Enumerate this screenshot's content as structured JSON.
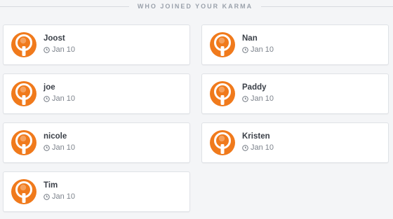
{
  "header": {
    "title": "WHO JOINED YOUR KARMA"
  },
  "members": [
    {
      "name": "Joost",
      "date": "Jan 10"
    },
    {
      "name": "Nan",
      "date": "Jan 10"
    },
    {
      "name": "joe",
      "date": "Jan 10"
    },
    {
      "name": "Paddy",
      "date": "Jan 10"
    },
    {
      "name": "nicole",
      "date": "Jan 10"
    },
    {
      "name": "Kristen",
      "date": "Jan 10"
    },
    {
      "name": "Tim",
      "date": "Jan 10"
    }
  ],
  "colors": {
    "avatar_orange": "#f07a1c",
    "avatar_light": "#ffffff",
    "name_text": "#3a3f47",
    "date_text": "#7d838c",
    "header_text": "#9aa1ab"
  },
  "icons": {
    "avatar": "karma-logo-icon",
    "date": "clock-icon"
  }
}
